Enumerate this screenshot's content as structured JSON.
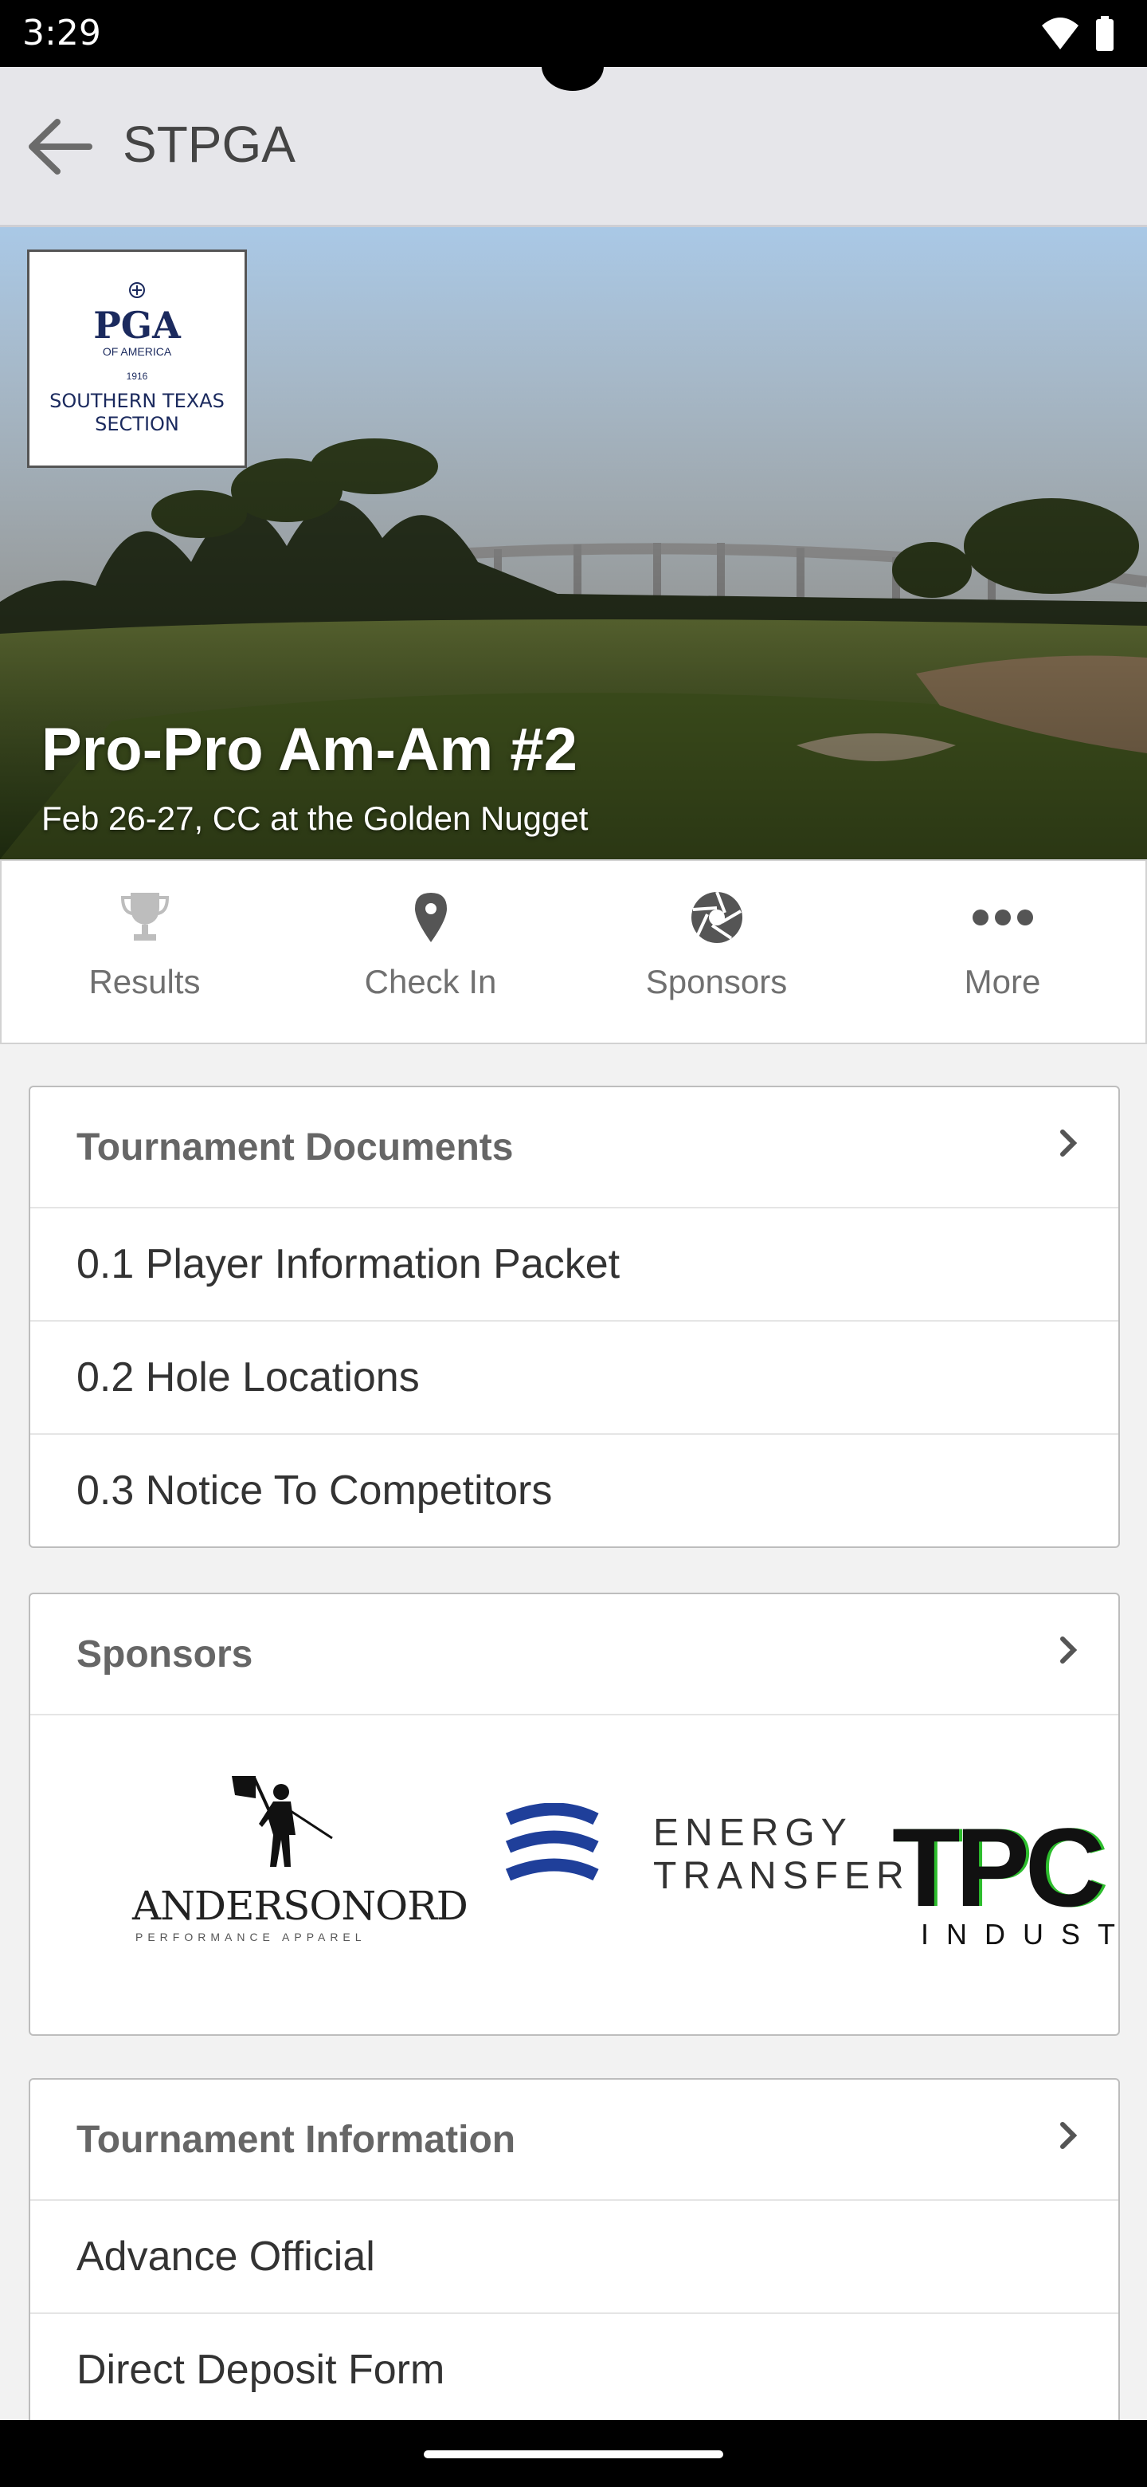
{
  "status_bar": {
    "time": "3:29"
  },
  "app_bar": {
    "title": "STPGA"
  },
  "hero": {
    "title": "Pro-Pro Am-Am #2",
    "subtitle": "Feb 26-27, CC at the Golden Nugget",
    "logo": {
      "brand": "PGA",
      "sub": "OF AMERICA",
      "year": "1916",
      "section_line1": "SOUTHERN TEXAS",
      "section_line2": "SECTION"
    }
  },
  "nav": [
    {
      "label": "Results",
      "icon": "trophy-icon"
    },
    {
      "label": "Check In",
      "icon": "map-pin-icon"
    },
    {
      "label": "Sponsors",
      "icon": "aperture-icon"
    },
    {
      "label": "More",
      "icon": "more-dots-icon"
    }
  ],
  "documents": {
    "title": "Tournament Documents",
    "items": [
      "0.1 Player Information Packet",
      "0.2 Hole Locations",
      "0.3 Notice To Competitors"
    ]
  },
  "sponsors": {
    "title": "Sponsors",
    "logos": [
      {
        "line1": "ANDERSONORD",
        "line2": "PERFORMANCE APPAREL"
      },
      {
        "line1": "ENERGY",
        "line2": "TRANSFER"
      },
      {
        "line1": "TPC",
        "line2": "INDUSTRIES"
      }
    ]
  },
  "info": {
    "title": "Tournament Information",
    "items": [
      "Advance Official",
      "Direct Deposit Form"
    ]
  },
  "colors": {
    "brand_navy": "#1b2a5e",
    "energy_blue": "#1f3f9a",
    "tpc_green": "#2dbd2d"
  }
}
